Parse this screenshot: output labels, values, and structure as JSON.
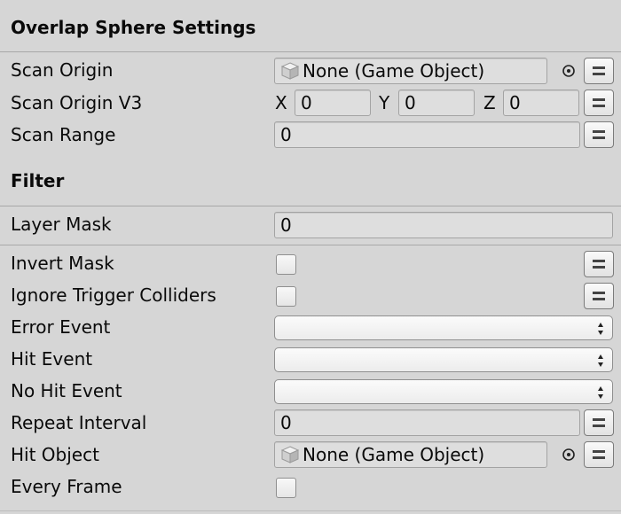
{
  "sections": {
    "overlap_title": "Overlap Sphere Settings",
    "filter_title": "Filter"
  },
  "fields": {
    "scan_origin": {
      "label": "Scan Origin",
      "value": "None (Game Object)"
    },
    "scan_origin_v3": {
      "label": "Scan Origin V3",
      "x_label": "X",
      "x": "0",
      "y_label": "Y",
      "y": "0",
      "z_label": "Z",
      "z": "0"
    },
    "scan_range": {
      "label": "Scan Range",
      "value": "0"
    },
    "layer_mask": {
      "label": "Layer Mask",
      "value": "0"
    },
    "invert_mask": {
      "label": "Invert Mask",
      "checked": false
    },
    "ignore_trigger": {
      "label": "Ignore Trigger Colliders",
      "checked": false
    },
    "error_event": {
      "label": "Error Event",
      "value": ""
    },
    "hit_event": {
      "label": "Hit Event",
      "value": ""
    },
    "no_hit_event": {
      "label": "No Hit Event",
      "value": ""
    },
    "repeat_interval": {
      "label": "Repeat Interval",
      "value": "0"
    },
    "hit_object": {
      "label": "Hit Object",
      "value": "None (Game Object)"
    },
    "every_frame": {
      "label": "Every Frame",
      "checked": false
    }
  },
  "icons": {
    "object": "game-object-cube-icon",
    "target": "object-picker-target-icon",
    "menu": "variable-menu-icon",
    "dropdown": "updown-arrows-icon"
  },
  "colors": {
    "background": "#d6d6d6",
    "field": "#dedede"
  }
}
